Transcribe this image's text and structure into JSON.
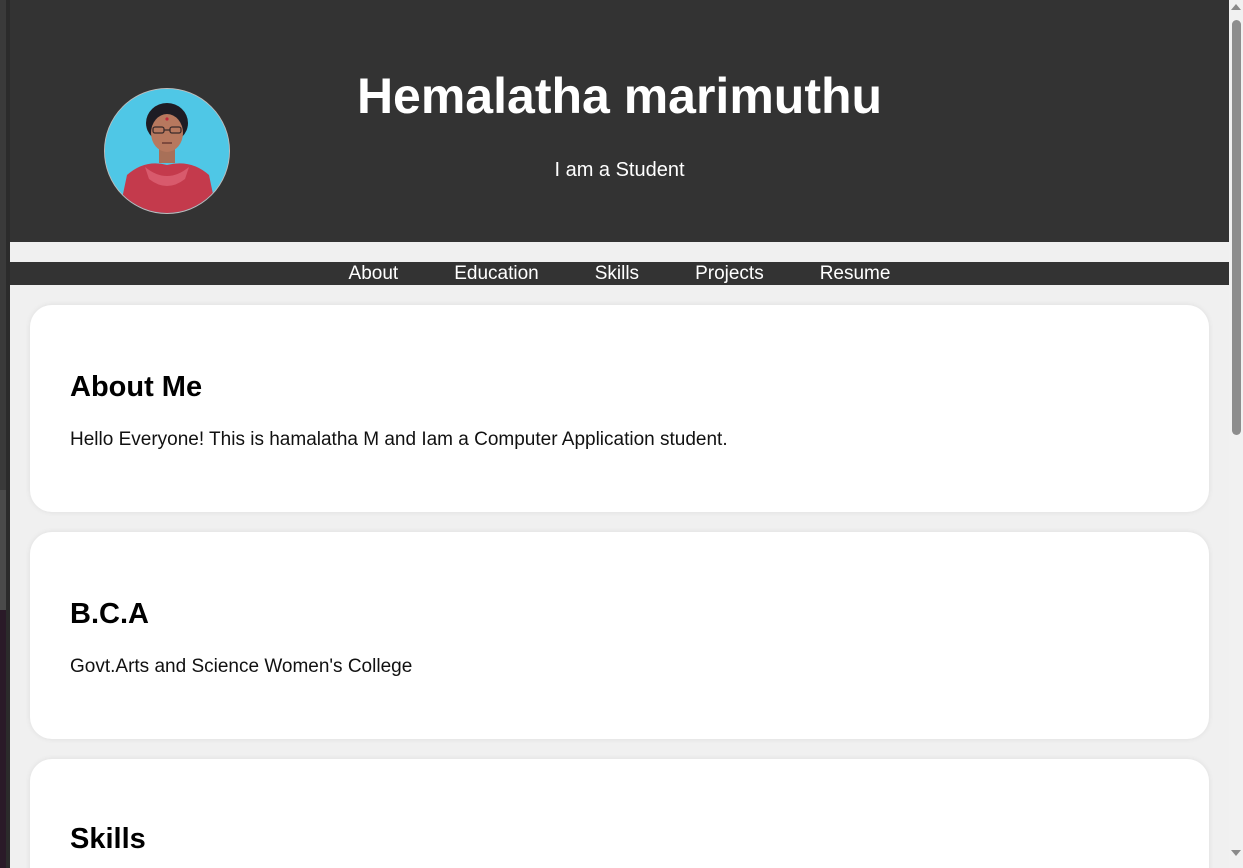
{
  "header": {
    "name": "Hemalatha marimuthu",
    "tagline": "I am a Student"
  },
  "nav": {
    "items": [
      "About",
      "Education",
      "Skills",
      "Projects",
      "Resume"
    ]
  },
  "sections": {
    "about": {
      "heading": "About Me",
      "text": "Hello Everyone! This is hamalatha M and Iam a Computer Application student."
    },
    "education": {
      "heading": "B.C.A",
      "text": "Govt.Arts and Science Women's College"
    },
    "skills": {
      "heading": "Skills"
    }
  },
  "colors": {
    "header_bg": "#333333",
    "page_bg": "#f0f0f0",
    "card_bg": "#ffffff",
    "avatar_bg": "#4fc7e6"
  }
}
